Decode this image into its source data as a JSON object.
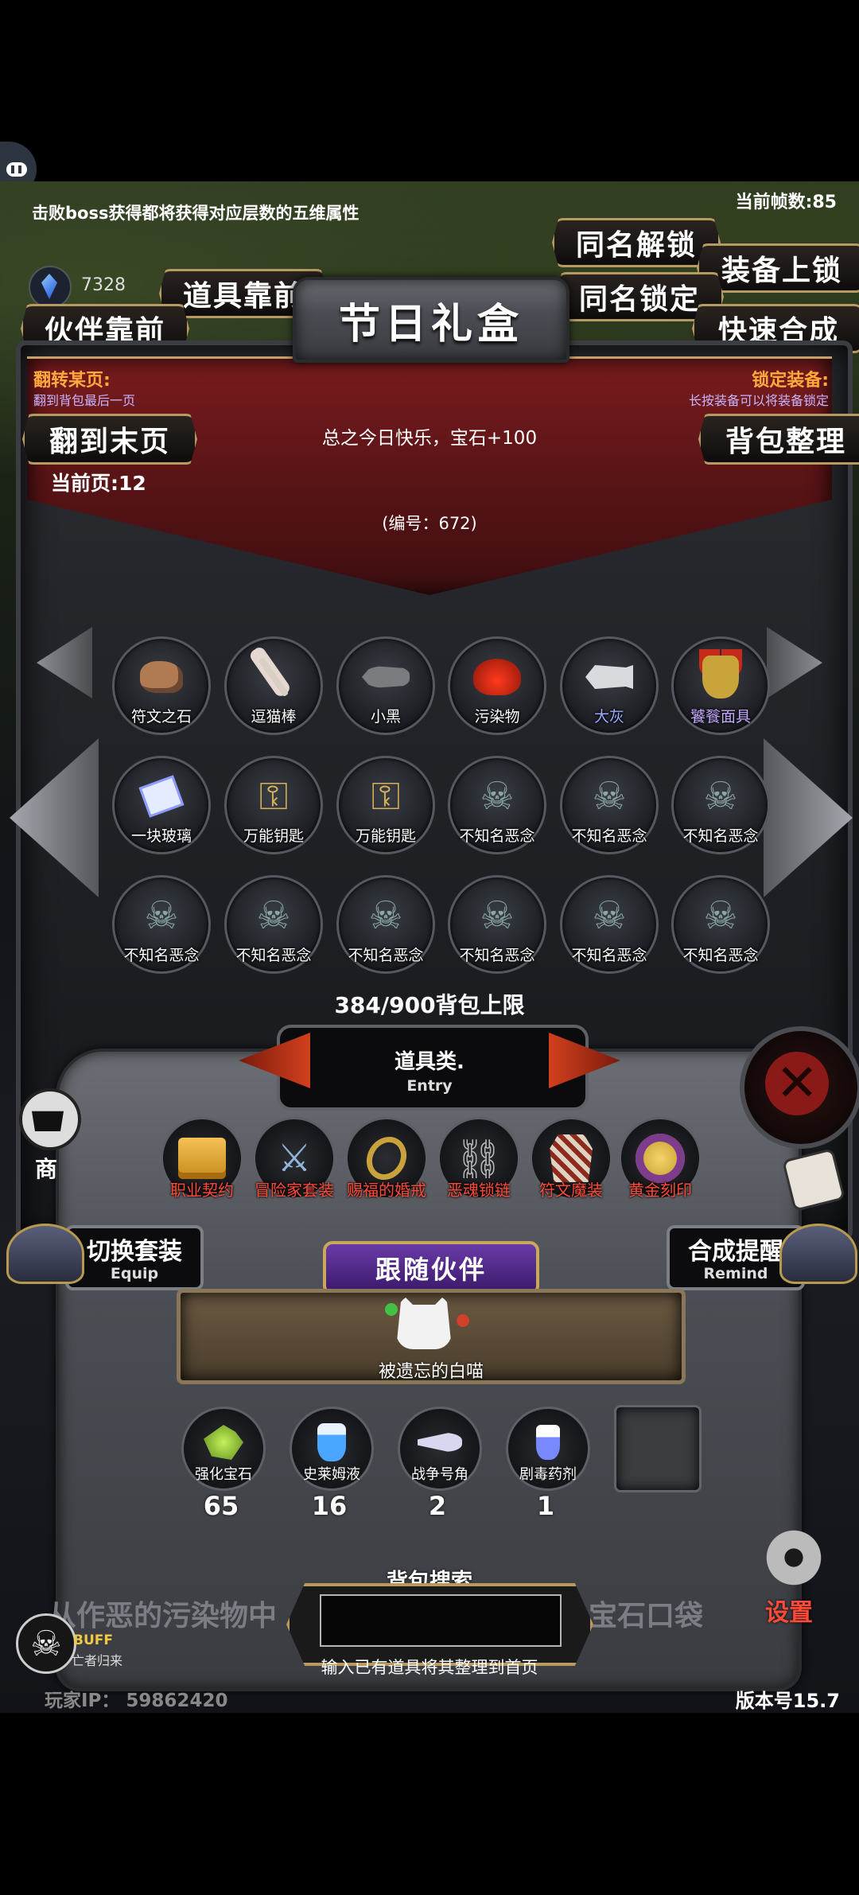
{
  "top": {
    "fps": "当前帧数:85",
    "hint": "击败boss获得都将获得对应层数的五维属性",
    "gems": "7328"
  },
  "buttons": {
    "same_unlock": "同名解锁",
    "equip_lock": "装备上锁",
    "item_front": "道具靠前",
    "partner_front": "伙伴靠前",
    "same_lock": "同名锁定",
    "quick_merge": "快速合成",
    "to_last_page": "翻到末页",
    "bag_sort": "背包整理"
  },
  "gift": {
    "title": "节日礼盒",
    "flip_title": "翻转某页:",
    "flip_sub": "翻到背包最后一页",
    "lock_title": "锁定装备:",
    "lock_sub": "长按装备可以将装备锁定",
    "message": "总之今日快乐，宝石+100",
    "serial": "(编号：672)",
    "current_page": "当前页:12"
  },
  "inventory": {
    "rows": [
      [
        {
          "name": "符文之石",
          "icon": "rune-stone",
          "color": "#fff"
        },
        {
          "name": "逗猫棒",
          "icon": "cat-wand",
          "color": "#fff"
        },
        {
          "name": "小黑",
          "icon": "black-fish",
          "color": "#fff"
        },
        {
          "name": "污染物",
          "icon": "pollutant",
          "color": "#fff"
        },
        {
          "name": "大灰",
          "icon": "grey-fish",
          "color": "#9aa9ff"
        },
        {
          "name": "饕餮面具",
          "icon": "taotie-mask",
          "color": "#c6a8ff"
        }
      ],
      [
        {
          "name": "一块玻璃",
          "icon": "glass",
          "color": "#fff"
        },
        {
          "name": "万能钥匙",
          "icon": "key",
          "color": "#fff"
        },
        {
          "name": "万能钥匙",
          "icon": "key",
          "color": "#fff"
        },
        {
          "name": "不知名恶念",
          "icon": "ghost",
          "color": "#fff"
        },
        {
          "name": "不知名恶念",
          "icon": "ghost",
          "color": "#fff"
        },
        {
          "name": "不知名恶念",
          "icon": "ghost",
          "color": "#fff"
        }
      ],
      [
        {
          "name": "不知名恶念",
          "icon": "ghost",
          "color": "#fff"
        },
        {
          "name": "不知名恶念",
          "icon": "ghost",
          "color": "#fff"
        },
        {
          "name": "不知名恶念",
          "icon": "ghost",
          "color": "#fff"
        },
        {
          "name": "不知名恶念",
          "icon": "ghost",
          "color": "#fff"
        },
        {
          "name": "不知名恶念",
          "icon": "ghost",
          "color": "#fff"
        },
        {
          "name": "不知名恶念",
          "icon": "ghost",
          "color": "#fff"
        }
      ]
    ],
    "capacity": "384/900背包上限"
  },
  "category": {
    "title": "道具类.",
    "sub": "Entry"
  },
  "tools": [
    {
      "name": "职业契约",
      "icon": "scroll"
    },
    {
      "name": "冒险家套装",
      "icon": "adventurer"
    },
    {
      "name": "赐福的婚戒",
      "icon": "ring"
    },
    {
      "name": "恶魂锁链",
      "icon": "chain"
    },
    {
      "name": "符文魔装",
      "icon": "rune-armor"
    },
    {
      "name": "黄金刻印",
      "icon": "gold-seal"
    }
  ],
  "side": {
    "switch_title": "切换套装",
    "switch_sub": "Equip",
    "remind_title": "合成提醒",
    "remind_sub": "Remind",
    "follow_title": "跟随伙伴",
    "partner_name": "被遗忘的白喵"
  },
  "bag_items": [
    {
      "name": "强化宝石",
      "icon": "green-gem",
      "count": "65"
    },
    {
      "name": "史莱姆液",
      "icon": "potion",
      "count": "16"
    },
    {
      "name": "战争号角",
      "icon": "horn",
      "count": "2"
    },
    {
      "name": "剧毒药剂",
      "icon": "poison",
      "count": "1"
    }
  ],
  "search": {
    "label": "背包搜索",
    "hint": "输入已有道具将其整理到首页",
    "bg_left": "从作恶的污染物中",
    "bg_right": "宝石口袋"
  },
  "misc": {
    "shop": "商",
    "settings": "设置",
    "buff": "BUFF",
    "buff_sub": "亡者归来",
    "player_ip": "玩家IP： 59862420",
    "version": "版本号15.7"
  }
}
